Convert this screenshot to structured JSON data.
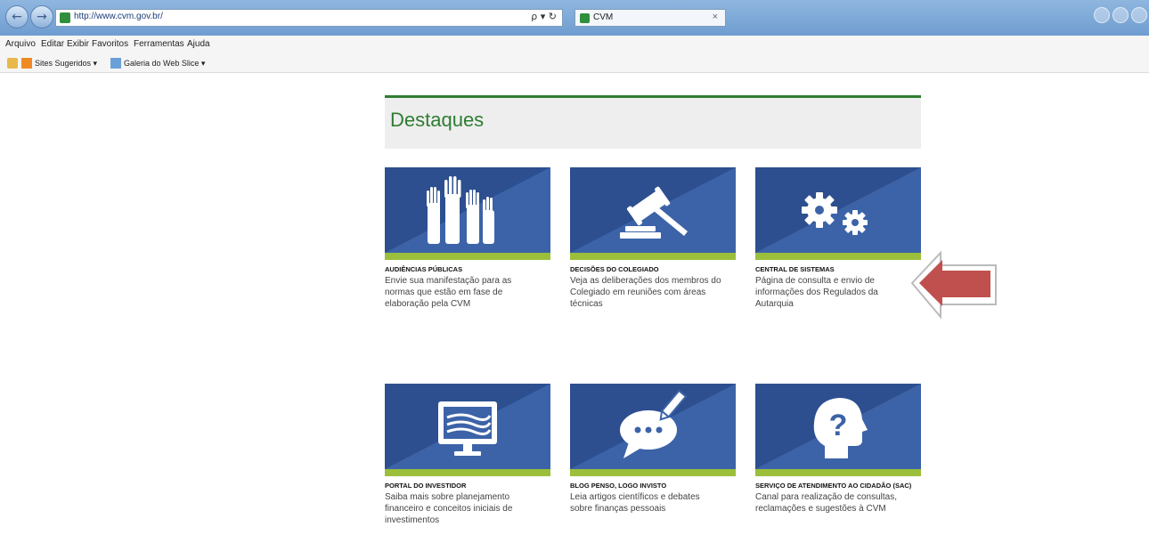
{
  "browser": {
    "url": "http://www.cvm.gov.br/",
    "tab_label": "CVM",
    "addr_controls": "ρ ▾ ↻",
    "tab_close": "×",
    "back_glyph": "←",
    "forward_glyph": "→"
  },
  "menu": {
    "items": [
      "Arquivo",
      "Editar",
      "Exibir",
      "Favoritos",
      "Ferramentas",
      "Ajuda"
    ]
  },
  "favorites_bar": {
    "items": [
      "Sites Sugeridos ▾",
      "Galeria do Web Slice ▾"
    ]
  },
  "page": {
    "section_title": "Destaques",
    "cards": [
      {
        "title": "AUDIÊNCIAS PÚBLICAS",
        "desc": "Envie sua manifestação para as normas que estão em fase de elaboração pela CVM",
        "icon": "raised-hands-icon"
      },
      {
        "title": "DECISÕES DO COLEGIADO",
        "desc": "Veja as deliberações dos membros do Colegiado em reuniões com áreas técnicas",
        "icon": "gavel-icon"
      },
      {
        "title": "CENTRAL DE SISTEMAS",
        "desc": "Página de consulta e envio de informações dos Regulados da Autarquia",
        "icon": "gears-icon"
      },
      {
        "title": "PORTAL DO INVESTIDOR",
        "desc": "Saiba mais sobre planejamento financeiro e conceitos iniciais de investimentos",
        "icon": "monitor-icon"
      },
      {
        "title": "BLOG PENSO, LOGO INVISTO",
        "desc": "Leia artigos científicos e debates sobre finanças pessoais",
        "icon": "speech-bubble-pen-icon"
      },
      {
        "title": "SERVIÇO DE ATENDIMENTO AO CIDADÃO (SAC)",
        "desc": "Canal para realização de consultas, reclamações e sugestões à CVM",
        "icon": "head-question-icon"
      }
    ]
  },
  "colors": {
    "banner_blue": "#3c63a8",
    "accent_green": "#2e7d32",
    "stripe_green": "#9bbf3b",
    "arrow_red": "#c0504d"
  }
}
